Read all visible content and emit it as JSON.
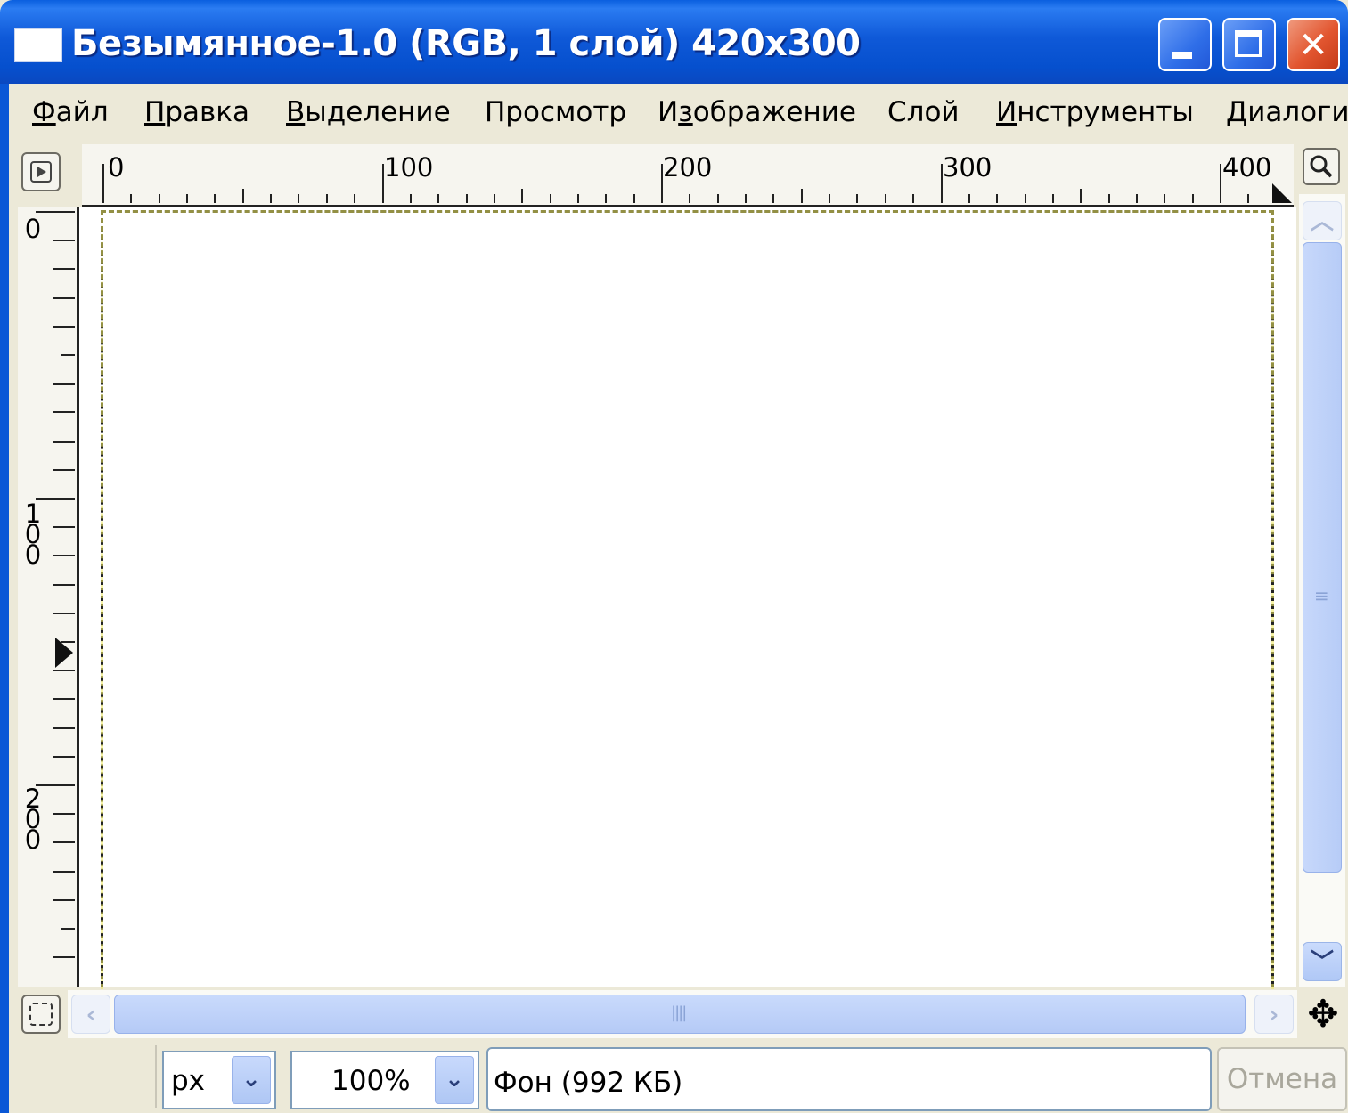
{
  "window": {
    "title": "Безымянное-1.0 (RGB, 1 слой) 420x300",
    "close_glyph": "✕"
  },
  "menu": [
    {
      "label": "Файл",
      "key": "Ф",
      "rest": "айл"
    },
    {
      "label": "Правка",
      "key": "П",
      "rest": "равка"
    },
    {
      "label": "Выделение",
      "key": "В",
      "rest": "ыделение"
    },
    {
      "label": "Просмотр",
      "key": "",
      "rest": "Просмотр"
    },
    {
      "label": "Изображение",
      "pre": "И",
      "key": "з",
      "rest": "ображение"
    },
    {
      "label": "Слой",
      "key": "",
      "rest": "Слой"
    },
    {
      "label": "Инструменты",
      "key": "И",
      "rest": "нструменты"
    },
    {
      "label": "Диалоги",
      "key": "",
      "rest": "Диалоги"
    }
  ],
  "ruler": {
    "h_labels": [
      "0",
      "100",
      "200",
      "300",
      "400"
    ],
    "v_labels": [
      "0",
      "1\n0\n0",
      "2\n0\n0"
    ]
  },
  "statusbar": {
    "unit": "px",
    "zoom": "100%",
    "layer_info": "Фон (992 КБ)",
    "cancel_label": "Отмена"
  },
  "icons": {
    "navigate": "play-icon",
    "zoom": "magnifier-icon",
    "quick_mask": "quick-mask-icon",
    "move": "move-icon"
  }
}
